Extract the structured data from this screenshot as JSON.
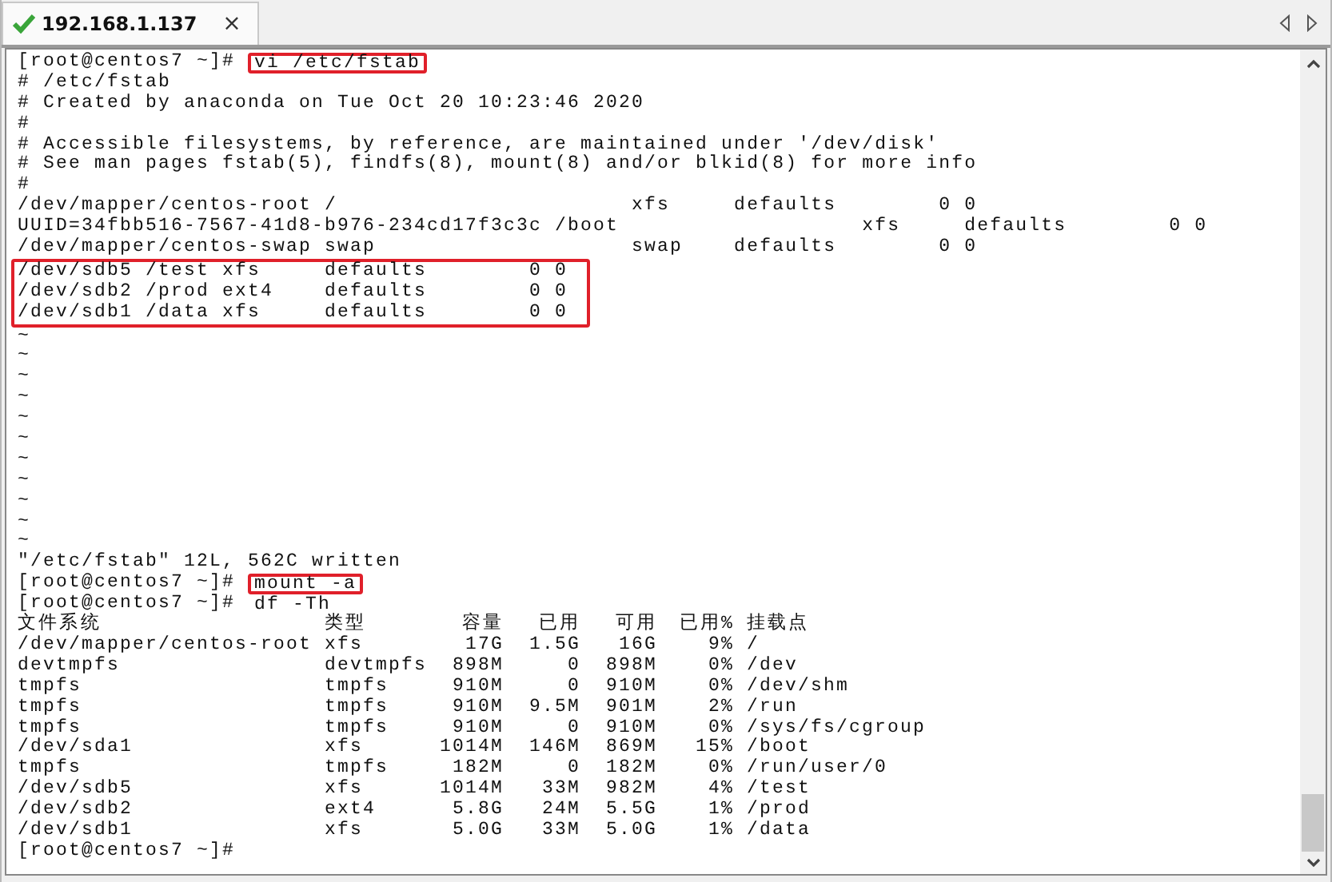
{
  "tabs": [
    {
      "label": "192.168.1.137",
      "close": "×",
      "selected": true
    }
  ],
  "terminal": {
    "lines": [
      {
        "kind": "prompt",
        "prompt": "[root@centos7 ~]# ",
        "command": "vi /etc/fstab",
        "highlighted": true
      },
      {
        "kind": "text",
        "text": "# /etc/fstab"
      },
      {
        "kind": "text",
        "text": "# Created by anaconda on Tue Oct 20 10:23:46 2020"
      },
      {
        "kind": "text",
        "text": "#"
      },
      {
        "kind": "text",
        "text": "# Accessible filesystems, by reference, are maintained under '/dev/disk'"
      },
      {
        "kind": "text",
        "text": "# See man pages fstab(5), findfs(8), mount(8) and/or blkid(8) for more info"
      },
      {
        "kind": "text",
        "text": "#"
      },
      {
        "kind": "text",
        "text": "/dev/mapper/centos-root /                       xfs     defaults        0 0"
      },
      {
        "kind": "text",
        "text": "UUID=34fbb516-7567-41d8-b976-234cd17f3c3c /boot                   xfs     defaults        0 0"
      },
      {
        "kind": "text",
        "text": "/dev/mapper/centos-swap swap                    swap    defaults        0 0"
      },
      {
        "kind": "group",
        "highlighted": true,
        "lines": [
          "/dev/sdb5 /test xfs     defaults        0 0",
          "/dev/sdb2 /prod ext4    defaults        0 0",
          "/dev/sdb1 /data xfs     defaults        0 0"
        ]
      },
      {
        "kind": "text",
        "text": "~"
      },
      {
        "kind": "text",
        "text": "~"
      },
      {
        "kind": "text",
        "text": "~"
      },
      {
        "kind": "text",
        "text": "~"
      },
      {
        "kind": "text",
        "text": "~"
      },
      {
        "kind": "text",
        "text": "~"
      },
      {
        "kind": "text",
        "text": "~"
      },
      {
        "kind": "text",
        "text": "~"
      },
      {
        "kind": "text",
        "text": "~"
      },
      {
        "kind": "text",
        "text": "~"
      },
      {
        "kind": "text",
        "text": "~"
      },
      {
        "kind": "text",
        "text": "\"/etc/fstab\" 12L, 562C written"
      },
      {
        "kind": "prompt",
        "prompt": "[root@centos7 ~]# ",
        "command": "mount -a",
        "highlighted": true
      },
      {
        "kind": "prompt",
        "prompt": "[root@centos7 ~]# ",
        "command": "df -Th",
        "highlighted": false
      },
      {
        "kind": "table",
        "columns": [
          "文件系统",
          "类型",
          "容量",
          "已用",
          "可用",
          "已用%",
          "挂载点"
        ],
        "rows": [
          [
            "/dev/mapper/centos-root",
            "xfs",
            "17G",
            "1.5G",
            "16G",
            "9%",
            "/"
          ],
          [
            "devtmpfs",
            "devtmpfs",
            "898M",
            "0",
            "898M",
            "0%",
            "/dev"
          ],
          [
            "tmpfs",
            "tmpfs",
            "910M",
            "0",
            "910M",
            "0%",
            "/dev/shm"
          ],
          [
            "tmpfs",
            "tmpfs",
            "910M",
            "9.5M",
            "901M",
            "2%",
            "/run"
          ],
          [
            "tmpfs",
            "tmpfs",
            "910M",
            "0",
            "910M",
            "0%",
            "/sys/fs/cgroup"
          ],
          [
            "/dev/sda1",
            "xfs",
            "1014M",
            "146M",
            "869M",
            "15%",
            "/boot"
          ],
          [
            "tmpfs",
            "tmpfs",
            "182M",
            "0",
            "182M",
            "0%",
            "/run/user/0"
          ],
          [
            "/dev/sdb5",
            "xfs",
            "1014M",
            "33M",
            "982M",
            "4%",
            "/test"
          ],
          [
            "/dev/sdb2",
            "ext4",
            "5.8G",
            "24M",
            "5.5G",
            "1%",
            "/prod"
          ],
          [
            "/dev/sdb1",
            "xfs",
            "5.0G",
            "33M",
            "5.0G",
            "1%",
            "/data"
          ]
        ]
      },
      {
        "kind": "prompt",
        "prompt": "[root@centos7 ~]# "
      }
    ]
  }
}
